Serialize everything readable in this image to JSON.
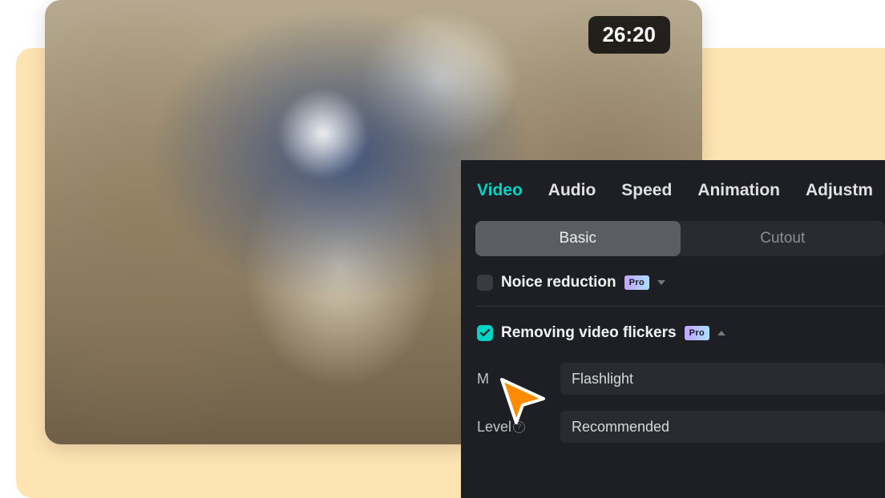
{
  "video": {
    "timestamp": "26:20"
  },
  "tabs": {
    "items": [
      "Video",
      "Audio",
      "Speed",
      "Animation",
      "Adjustm"
    ],
    "activeIndex": 0
  },
  "subtabs": {
    "items": [
      "Basic",
      "Cutout"
    ],
    "activeIndex": 0
  },
  "options": {
    "noise": {
      "label": "Noice reduction",
      "checked": false,
      "expanded": false
    },
    "flicker": {
      "label": "Removing video flickers",
      "checked": true,
      "expanded": true
    }
  },
  "proBadge": "Pro",
  "fields": {
    "mode": {
      "label": "M",
      "value": "Flashlight"
    },
    "level": {
      "label": "Level",
      "value": "Recommended"
    }
  }
}
